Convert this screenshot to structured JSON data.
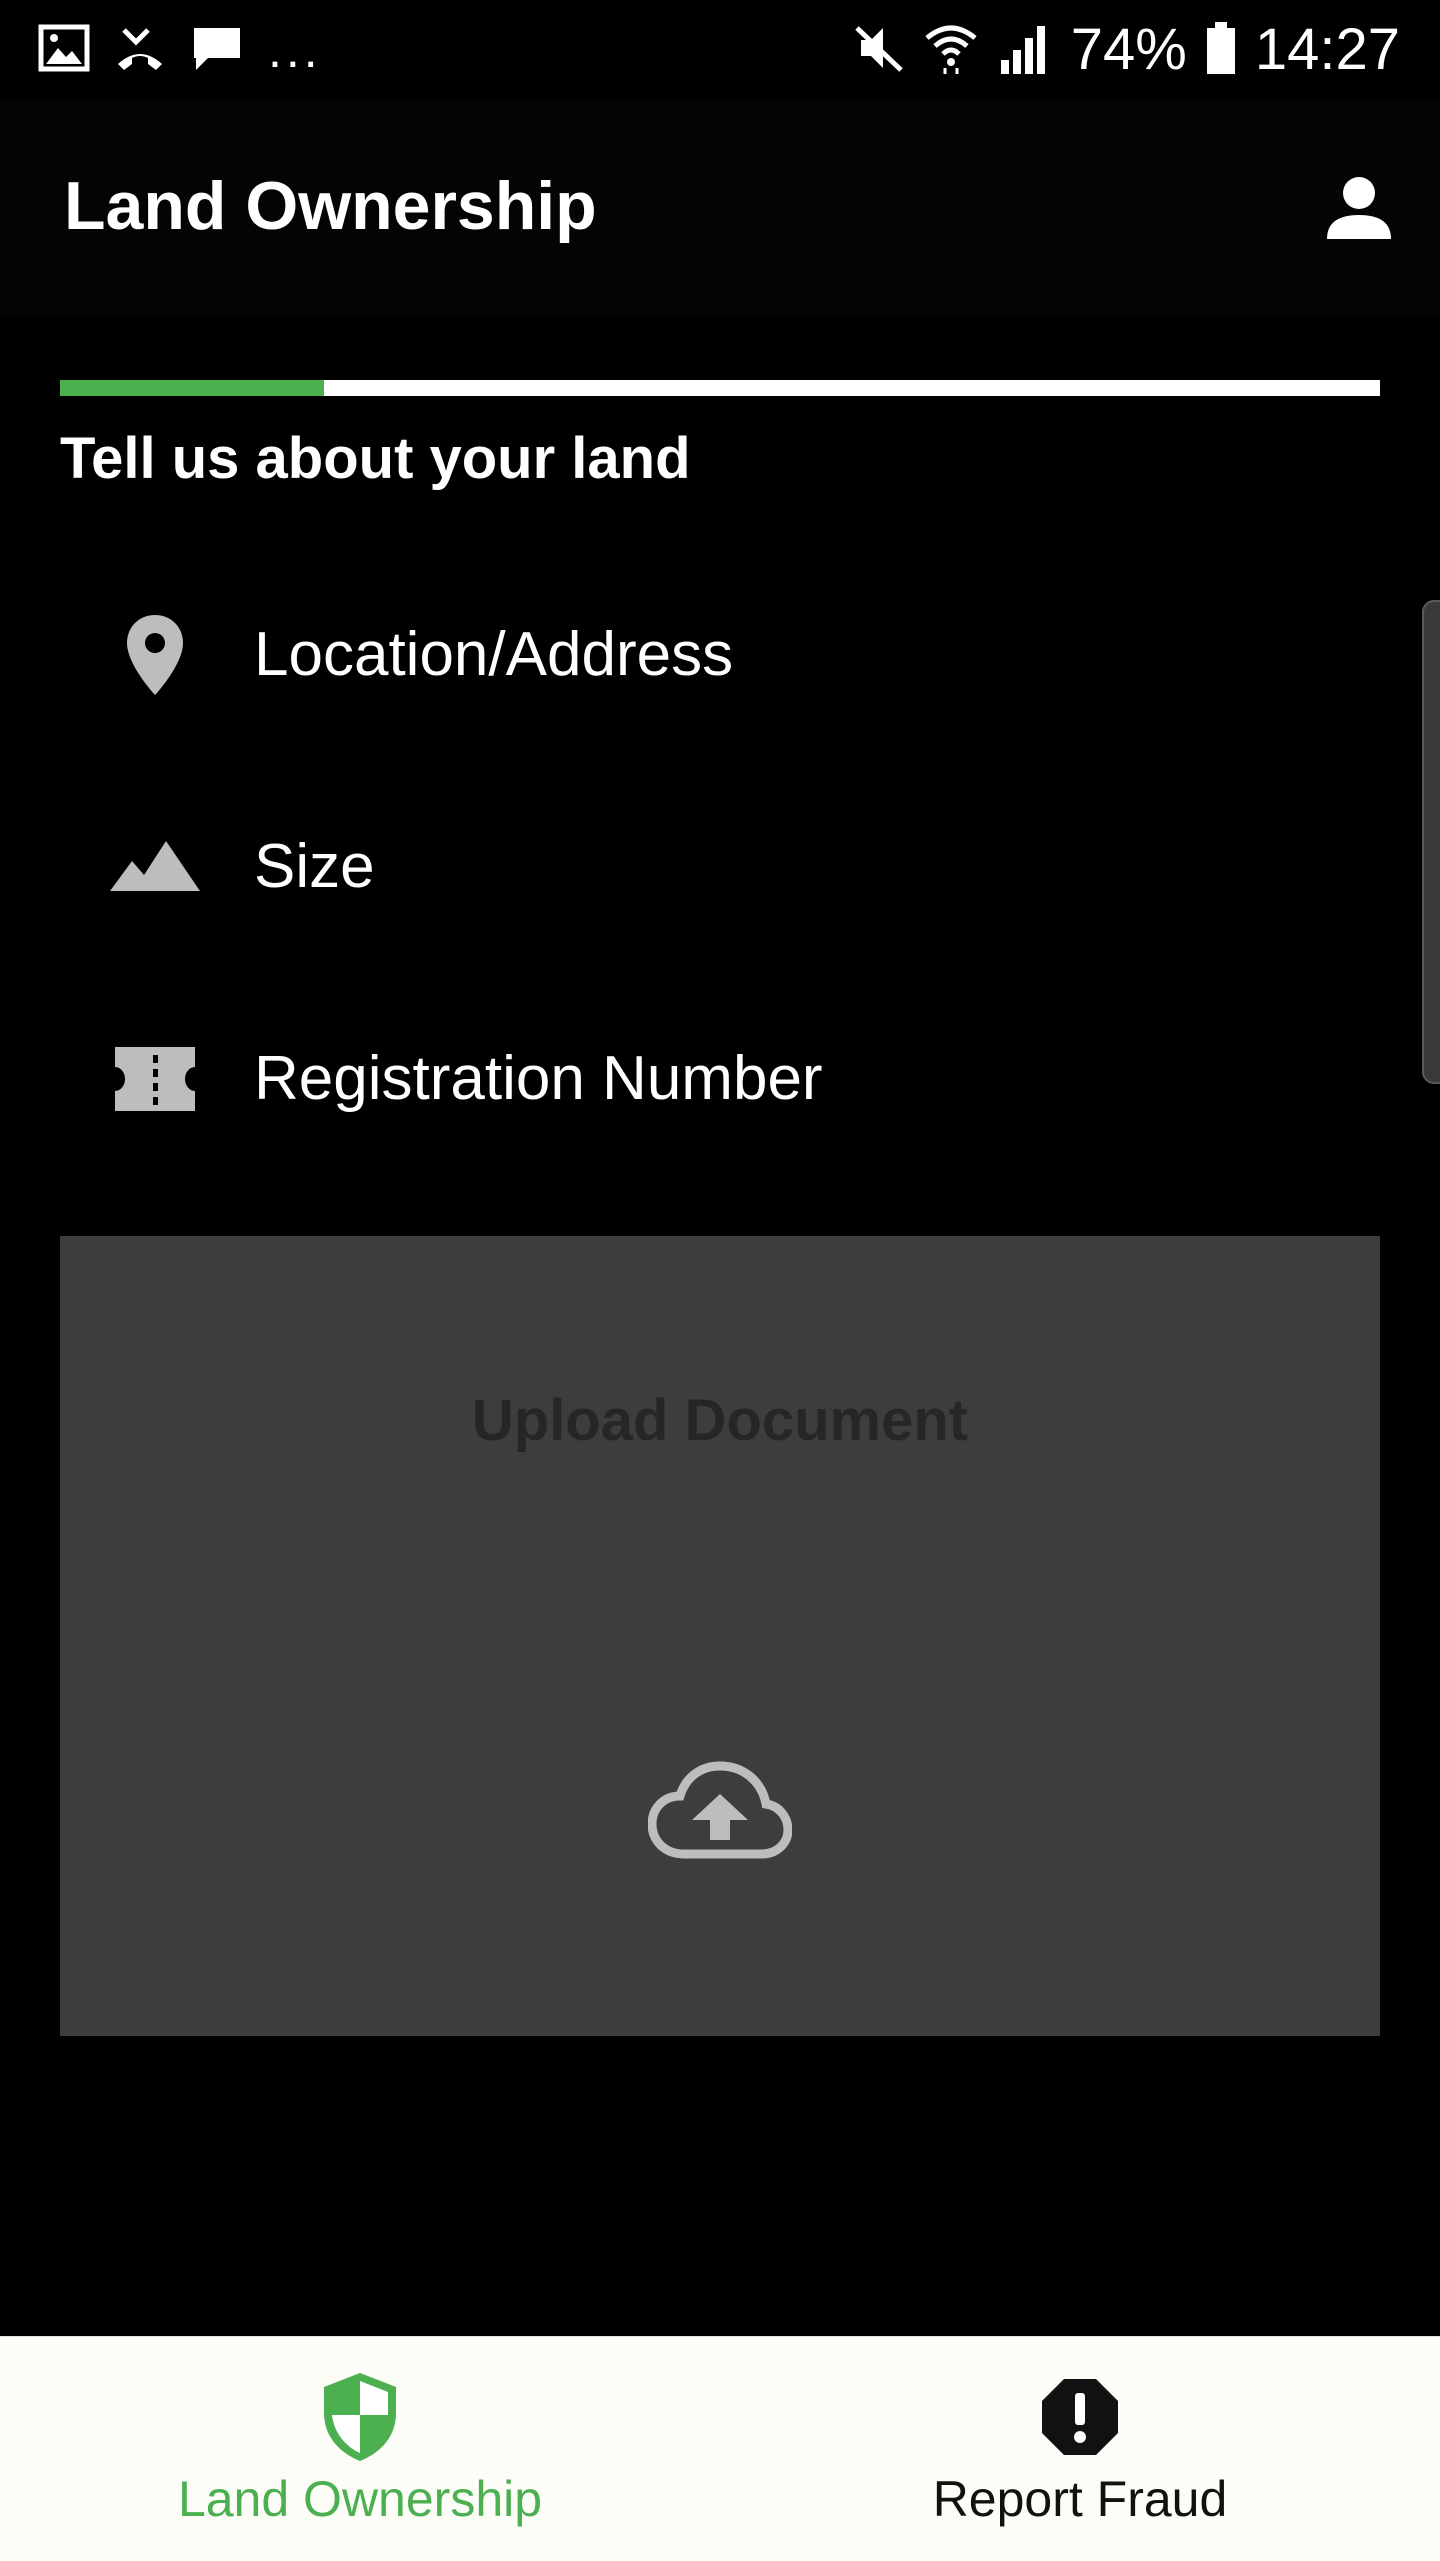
{
  "status_bar": {
    "overflow_dots": "...",
    "battery_percent": "74%",
    "time": "14:27",
    "icons": [
      "image-icon",
      "missed-call-icon",
      "message-icon",
      "mute-icon",
      "wifi-icon",
      "signal-icon",
      "battery-icon"
    ]
  },
  "appbar": {
    "title": "Land Ownership",
    "profile_icon": "person-icon"
  },
  "progress": {
    "fraction": 0.2
  },
  "section": {
    "heading": "Tell us about your land"
  },
  "form": {
    "items": [
      {
        "label": "Location/Address",
        "icon": "location-pin-icon"
      },
      {
        "label": "Size",
        "icon": "terrain-icon"
      },
      {
        "label": "Registration Number",
        "icon": "ticket-icon"
      }
    ]
  },
  "upload": {
    "title": "Upload Document",
    "icon": "cloud-upload-icon"
  },
  "bottom_nav": {
    "items": [
      {
        "label": "Land Ownership",
        "icon": "shield-icon",
        "active": true
      },
      {
        "label": "Report Fraud",
        "icon": "alert-octagon-icon",
        "active": false
      }
    ]
  },
  "colors": {
    "accent": "#4caf50",
    "background": "#000000",
    "card": "#3d3d3d",
    "nav_background": "#fcfdf7"
  }
}
